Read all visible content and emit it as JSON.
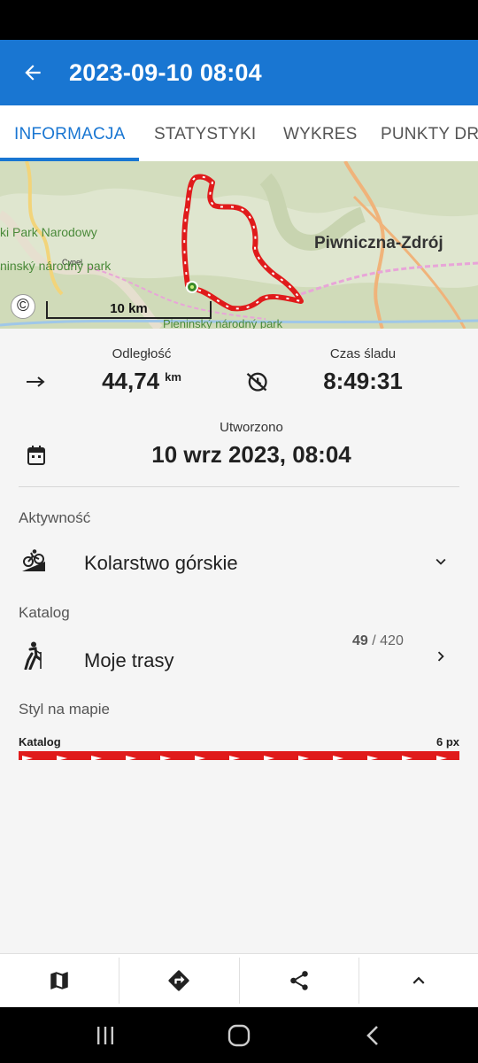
{
  "app_bar": {
    "title": "2023-09-10 08:04"
  },
  "tabs": [
    {
      "label": "INFORMACJA"
    },
    {
      "label": "STATYSTYKI"
    },
    {
      "label": "WYKRES"
    },
    {
      "label": "PUNKTY DRO"
    }
  ],
  "map": {
    "labels": {
      "park_top": "ki Park Narodowy",
      "cypel": "Cypel",
      "park_middle": "ninský národný park",
      "town": "Piwniczna-Zdrój",
      "park_bottom": "Pieninský národný park"
    },
    "scale": "10 km",
    "copyright_symbol": "©",
    "route_color": "#e01b1b"
  },
  "stats": {
    "distance_label": "Odległość",
    "distance_value": "44,74",
    "distance_unit": "km",
    "time_label": "Czas śladu",
    "time_value": "8:49:31",
    "created_label": "Utworzono",
    "created_value": "10 wrz 2023, 08:04"
  },
  "activity": {
    "section_label": "Aktywność",
    "value": "Kolarstwo górskie"
  },
  "catalog": {
    "section_label": "Katalog",
    "value": "Moje trasy",
    "count_current": "49",
    "count_separator": " / ",
    "count_total": "420"
  },
  "map_style": {
    "section_label": "Styl na mapie",
    "catalog_label": "Katalog",
    "width_label": "6 px",
    "line_color": "#e01b1b"
  },
  "colors": {
    "primary": "#1976d2",
    "route": "#e01b1b"
  }
}
